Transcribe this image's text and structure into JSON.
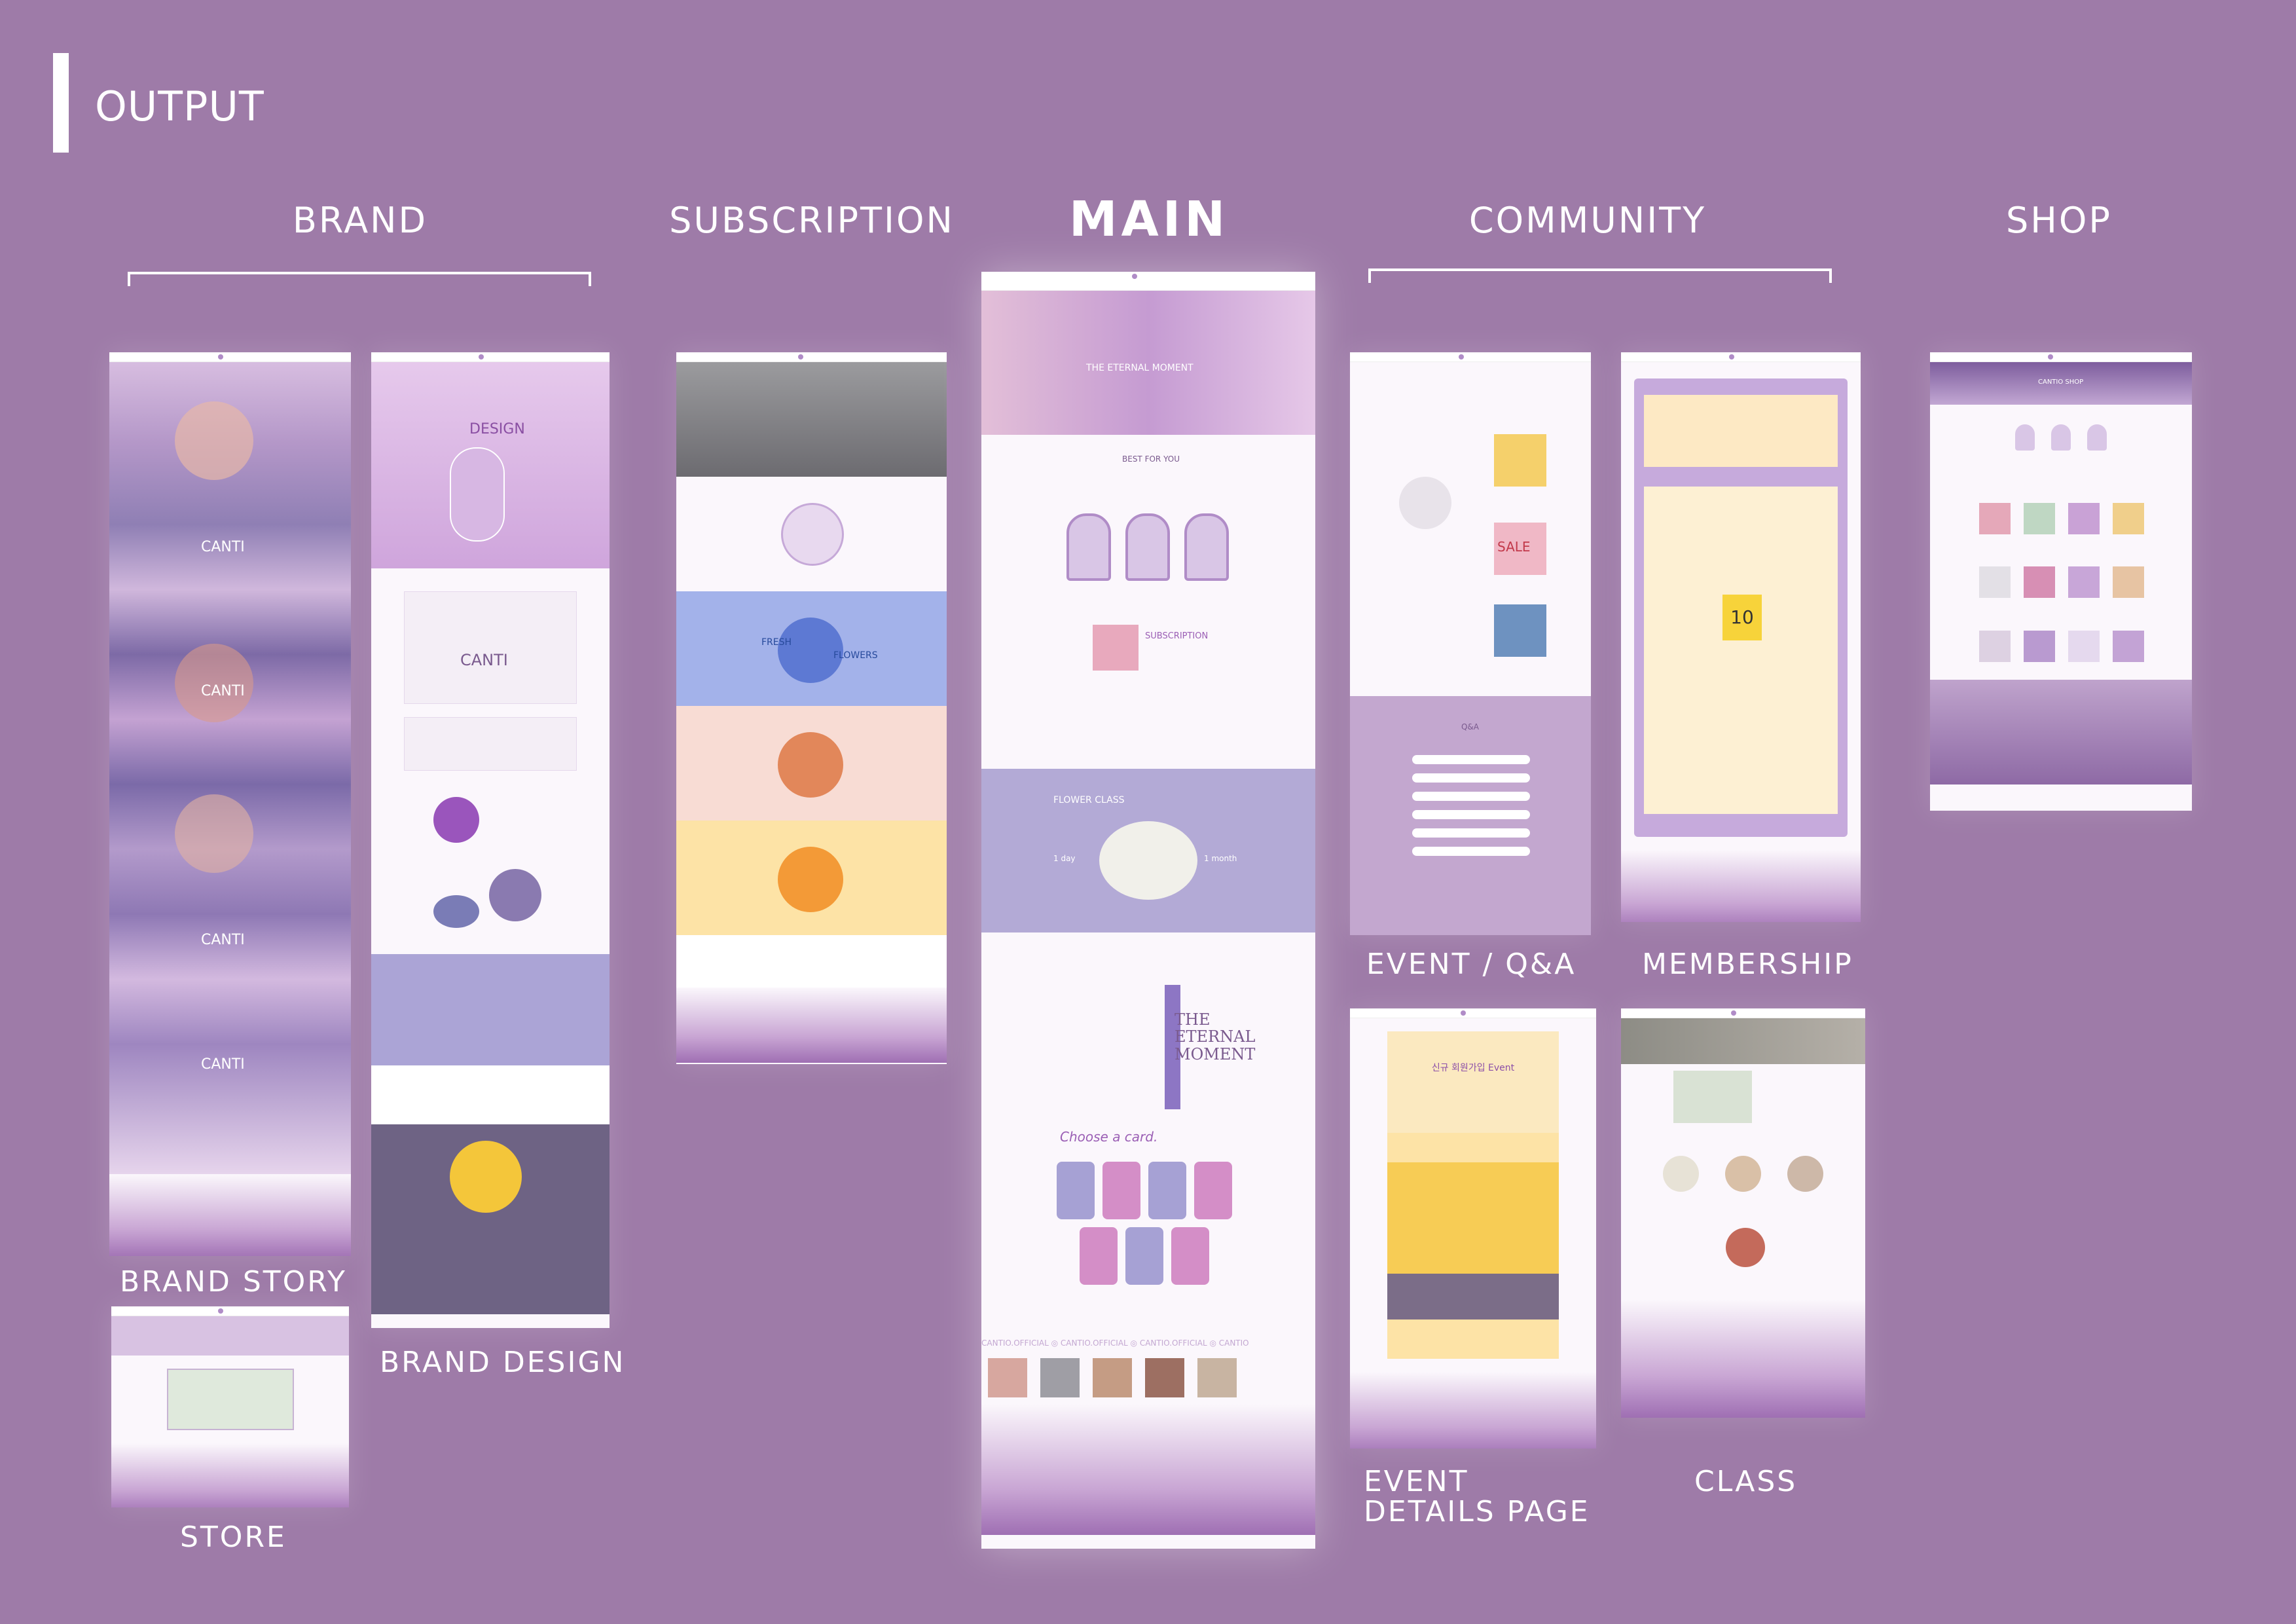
{
  "header": {
    "title": "OUTPUT"
  },
  "columns": {
    "brand": "BRAND",
    "subscription": "SUBSCRIPTION",
    "main": "MAIN",
    "community": "COMMUNITY",
    "shop": "SHOP"
  },
  "captions": {
    "brand_story": "BRAND STORY",
    "store": "STORE",
    "brand_design": "BRAND DESIGN",
    "event_qa": "EVENT / Q&A",
    "membership": "MEMBERSHIP",
    "event_details_line1": "EVENT",
    "event_details_line2": "DETAILS PAGE",
    "class": "CLASS"
  },
  "thumb_text": {
    "canto": "CANTI",
    "design": "DESIGN",
    "fresh": "FRESH",
    "flowers": "FLOWERS",
    "eternal_line1": "THE",
    "eternal_line2": "ETERNAL",
    "eternal_line3": "MOMENT",
    "the_eternal_moment": "THE ETERNAL MOMENT",
    "best_for_you": "BEST FOR YOU",
    "subscription": "SUBSCRIPTION",
    "flower_class": "FLOWER CLASS",
    "one_day": "1 day",
    "one_month": "1 month",
    "choose_card": "Choose a card.",
    "official": "CANTIO.OFFICIAL  ◎ CANTIO.OFFICIAL  ◎ CANTIO.OFFICIAL  ◎ CANTIO",
    "sale": "SALE",
    "qa": "Q&A",
    "event_ko": "신규 회원가입 Event",
    "ten": "10",
    "shop_name": "CANTIO SHOP"
  },
  "colors": {
    "background": "#9e7ba8",
    "accent_purple": "#9b7bc4",
    "lavender": "#b3aad6",
    "peach": "#f8dcd4",
    "yellow": "#fde3a6",
    "page": "#fbf7fc"
  }
}
